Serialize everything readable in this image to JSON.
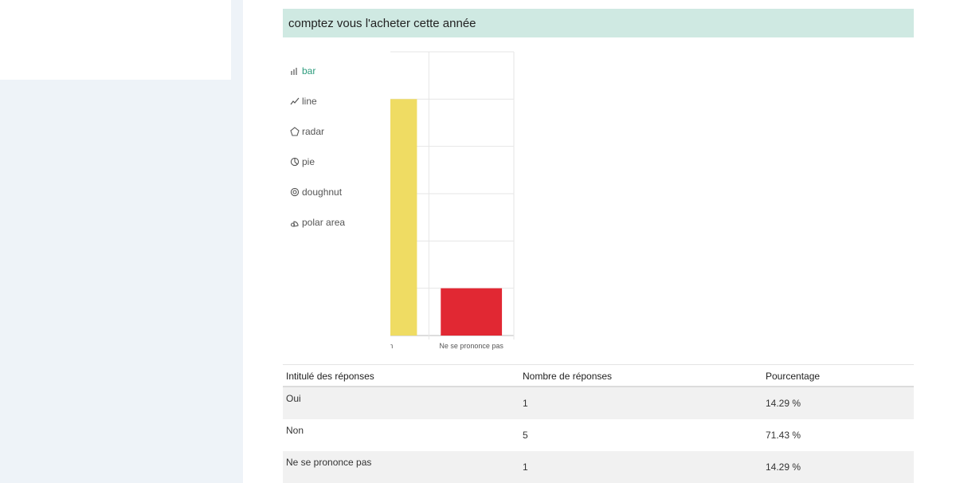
{
  "question": {
    "title": "comptez vous l'acheter cette année"
  },
  "chart_types": [
    {
      "label": "bar",
      "icon": "bar-chart-icon",
      "active": true
    },
    {
      "label": "line",
      "icon": "line-chart-icon",
      "active": false
    },
    {
      "label": "radar",
      "icon": "radar-chart-icon",
      "active": false
    },
    {
      "label": "pie",
      "icon": "pie-chart-icon",
      "active": false
    },
    {
      "label": "doughnut",
      "icon": "doughnut-chart-icon",
      "active": false
    },
    {
      "label": "polar area",
      "icon": "polar-area-chart-icon",
      "active": false
    }
  ],
  "chart_data": {
    "type": "bar",
    "title": "",
    "xlabel": "",
    "ylabel": "",
    "categories": [
      "Oui",
      "Non",
      "Ne se prononce pas"
    ],
    "values": [
      1,
      5,
      1
    ],
    "colors": [
      "#229079",
      "#efdc63",
      "#e12833"
    ],
    "ylim": [
      0,
      6
    ],
    "yticks": [
      "0",
      "1",
      "2",
      "3",
      "4",
      "5",
      "6"
    ],
    "grid": true,
    "legend": "none"
  },
  "table": {
    "headers": [
      "Intitulé des réponses",
      "Nombre de réponses",
      "Pourcentage"
    ],
    "rows": [
      [
        "Oui",
        "1",
        "14.29 %"
      ],
      [
        "Non",
        "5",
        "71.43 %"
      ],
      [
        "Ne se prononce pas",
        "1",
        "14.29 %"
      ]
    ]
  }
}
